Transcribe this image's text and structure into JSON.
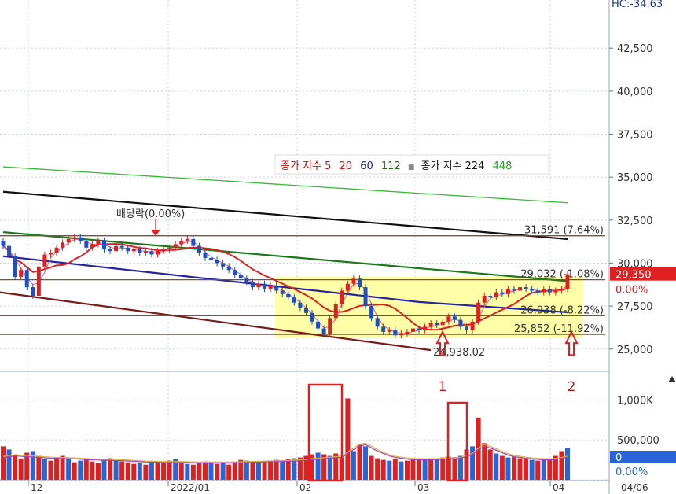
{
  "header": {
    "right_readout": "HC:-34.63"
  },
  "legend": {
    "items": [
      {
        "label": "종가 지수 5",
        "color": "#cc1111"
      },
      {
        "label": "20",
        "color": "#cc1111"
      },
      {
        "label": "60",
        "color": "#1a1a99"
      },
      {
        "label": "112",
        "color": "#1a6a1a"
      },
      {
        "label": "■",
        "color": "#888888"
      },
      {
        "label": "종가 지수 224",
        "color": "#111111"
      },
      {
        "label": "448",
        "color": "#22aa22"
      }
    ]
  },
  "chart_data": [
    {
      "type": "candlestick",
      "price_axis": {
        "ticks": [
          "42,500",
          "40,000",
          "37,500",
          "35,000",
          "32,500",
          "30,000",
          "27,500",
          "25,000"
        ],
        "tick_values": [
          42500,
          40000,
          37500,
          35000,
          32500,
          30000,
          27500,
          25000
        ],
        "ylim": [
          23800,
          45300
        ]
      },
      "x_axis": {
        "ticks": [
          "12",
          "2022/01",
          "02",
          "03",
          "04"
        ],
        "end_label": "04/06"
      },
      "current_price": {
        "label": "29,350",
        "value": 29350,
        "pct": "0.00%"
      },
      "horizontal_levels": [
        {
          "value": 31591,
          "label": "31,591 (7.64%)"
        },
        {
          "value": 29032,
          "label": "29,032 (-1.08%)"
        },
        {
          "value": 26938,
          "label": "26,938 (-8.22%)"
        },
        {
          "value": 25852,
          "label": "25,852 (-11.92%)"
        }
      ],
      "low_annotation": {
        "value": 24938.02,
        "label": "24,938.02"
      },
      "dividend_annotation": {
        "label": "배당락(0.00%)"
      },
      "signal_arrows": [
        {
          "label": "1",
          "value": 25000
        },
        {
          "label": "2",
          "value": 25000
        }
      ],
      "series": [
        {
          "name": "5",
          "color": "#e02020"
        },
        {
          "name": "20",
          "color": "#e02020"
        },
        {
          "name": "60",
          "color": "#2424a0"
        },
        {
          "name": "112",
          "color": "#1a7a1a"
        },
        {
          "name": "224",
          "color": "#111111"
        },
        {
          "name": "448",
          "color": "#33bb33"
        }
      ],
      "candles_close": [
        31000,
        30400,
        29200,
        29600,
        28600,
        28100,
        29800,
        30500,
        30600,
        30900,
        31200,
        31400,
        31500,
        31300,
        30900,
        31100,
        31300,
        30800,
        30700,
        31000,
        30900,
        30700,
        30800,
        30600,
        30700,
        30500,
        30700,
        30800,
        30900,
        31100,
        31300,
        31400,
        31000,
        30600,
        30300,
        30200,
        30000,
        29800,
        29600,
        29300,
        29100,
        28900,
        28600,
        28800,
        28500,
        28700,
        28400,
        28200,
        28000,
        27700,
        27400,
        27100,
        26600,
        26200,
        25900,
        26800,
        27600,
        28400,
        28800,
        29100,
        28600,
        27500,
        26800,
        26300,
        26000,
        26100,
        25800,
        25900,
        26000,
        26200,
        26100,
        26300,
        26500,
        26400,
        26600,
        26900,
        26700,
        26300,
        26100,
        26600,
        27700,
        28100,
        28000,
        28300,
        28200,
        28500,
        28400,
        28600,
        28500,
        28400,
        28300,
        28500,
        28300,
        28400,
        28500,
        29350
      ]
    },
    {
      "type": "bar",
      "title": "volume",
      "y_axis": {
        "ticks": [
          "1,000K",
          "500,000",
          "0"
        ],
        "tick_values": [
          1000000,
          500000,
          0
        ],
        "ylim": [
          0,
          1300000
        ]
      },
      "current_volume": {
        "label": "0",
        "pct": "0.00%"
      },
      "highlight_labels": [
        "1",
        "2"
      ],
      "volumes": [
        420000,
        380000,
        300000,
        260000,
        340000,
        360000,
        300000,
        260000,
        240000,
        280000,
        300000,
        260000,
        220000,
        240000,
        260000,
        230000,
        210000,
        250000,
        270000,
        240000,
        230000,
        220000,
        200000,
        210000,
        190000,
        230000,
        210000,
        220000,
        240000,
        260000,
        210000,
        200000,
        190000,
        210000,
        230000,
        220000,
        200000,
        210000,
        190000,
        220000,
        250000,
        240000,
        220000,
        210000,
        230000,
        240000,
        250000,
        230000,
        260000,
        270000,
        280000,
        300000,
        320000,
        340000,
        320000,
        300000,
        330000,
        280000,
        1020000,
        360000,
        440000,
        420000,
        300000,
        270000,
        250000,
        240000,
        260000,
        230000,
        240000,
        250000,
        260000,
        250000,
        270000,
        260000,
        280000,
        290000,
        270000,
        300000,
        380000,
        420000,
        780000,
        460000,
        380000,
        330000,
        300000,
        280000,
        290000,
        270000,
        260000,
        250000,
        240000,
        260000,
        250000,
        300000,
        360000,
        400000
      ],
      "volume_ma": [
        280000,
        290000,
        300000,
        295000,
        290000,
        285000,
        280000,
        275000,
        270000,
        268000,
        266000,
        264000,
        262000,
        258000,
        254000,
        250000,
        248000,
        246000,
        244000,
        242000,
        240000,
        236000,
        232000,
        228000,
        224000,
        222000,
        220000,
        218000,
        218000,
        218000,
        218000,
        216000,
        214000,
        212000,
        212000,
        212000,
        212000,
        212000,
        212000,
        214000,
        216000,
        218000,
        220000,
        222000,
        224000,
        226000,
        228000,
        230000,
        232000,
        236000,
        240000,
        246000,
        252000,
        258000,
        264000,
        270000,
        276000,
        282000,
        330000,
        380000,
        420000,
        440000,
        400000,
        360000,
        330000,
        300000,
        280000,
        270000,
        260000,
        255000,
        252000,
        250000,
        252000,
        254000,
        258000,
        262000,
        266000,
        270000,
        290000,
        320000,
        380000,
        420000,
        400000,
        370000,
        340000,
        310000,
        290000,
        280000,
        270000,
        262000,
        256000,
        252000,
        250000,
        256000,
        268000,
        282000
      ]
    }
  ]
}
